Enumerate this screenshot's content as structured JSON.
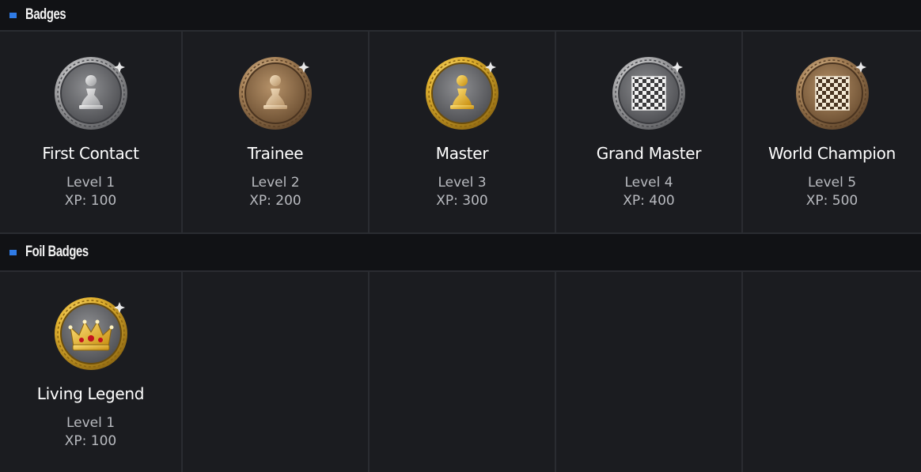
{
  "sections": {
    "badges": {
      "title": "Badges",
      "items": [
        {
          "name": "First Contact",
          "level": "Level 1",
          "xp": "XP: 100",
          "icon": "silver-pawn-medal-icon"
        },
        {
          "name": "Trainee",
          "level": "Level 2",
          "xp": "XP: 200",
          "icon": "bronze-pawn-medal-icon"
        },
        {
          "name": "Master",
          "level": "Level 3",
          "xp": "XP: 300",
          "icon": "gold-pawn-medal-icon"
        },
        {
          "name": "Grand Master",
          "level": "Level 4",
          "xp": "XP: 400",
          "icon": "silver-chessboard-medal-icon"
        },
        {
          "name": "World Champion",
          "level": "Level 5",
          "xp": "XP: 500",
          "icon": "bronze-chessboard-medal-icon"
        }
      ]
    },
    "foil": {
      "title": "Foil Badges",
      "items": [
        {
          "name": "Living Legend",
          "level": "Level 1",
          "xp": "XP: 100",
          "icon": "gold-crown-medal-icon"
        }
      ]
    }
  },
  "colors": {
    "accent": "#2f7be6",
    "background": "#1b1c20",
    "header_background": "#111215",
    "divider": "#2a2c31"
  }
}
